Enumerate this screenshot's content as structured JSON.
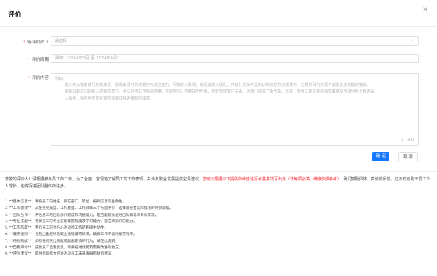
{
  "dialog": {
    "title": "评价"
  },
  "form": {
    "employee": {
      "label": "待评价员工",
      "placeholder": "请选择"
    },
    "period": {
      "label": "评价周期",
      "placeholder": "例如：'2024年1月 至 2024年6月'"
    },
    "content": {
      "label": "评价内容",
      "placeholder": "例如：\n        我三作为销售部门的新成员，展现出极可贵的潜力与适应能力。尽管初入职场，他迅速融入团队，凭借扎实的产品知识和良好的沟通技巧，在短时间内实现了销售业绩的稳定增长。\n        展现出超过同期新人的销售潜力，张三对待工作热情饱满，主动学习，不断提升自我，有效管理客户关系，为部门带来了新气象。未来，望张三能在复杂销售策略及市场分析上有更深\n        入探索，相信他定能在销售领域取得更耀眼的成绩。",
      "count": "0 / 300"
    },
    "confirm_label": "确 定",
    "cancel_label": "取 消"
  },
  "description": {
    "intro": "尊敬的评价人！请根据参与员工的工作，为了全面、客观地了解员工的工作表现，并为其职业发展提供宝贵建议，",
    "warning": "您可以根据以下提供的维度进行考量并填写出点（非每项必填，维度仅供参考）",
    "outro": "，我们鼓励具体、真诚的反馈，这不仅有助于员工个人成长，也将促进团队整体的进步。"
  },
  "criteria": [
    "1. **基本信息**：请按员工的姓名、所在部门、职位、编制信息的准确性。",
    "2. **工作绩效**：从任务完成度、工作质量、工作效率三个方面评价，选择最符合实际情况的评价等级。",
    "3. **团队合作**：评估员工的团队协作态度和沟通能力，是否能有效促进团队和谐与目标实现。",
    "4. **专业技能**：考察员工的专业技能掌握程度及学习能力，适应新知识的能力。",
    "5. **工作态度**：评价员工的责任心及对待工作的积极主动性。",
    "6. **遵守规则**：包括出勤纪律及职业道德遵守情况，确保工作环境的规范有序。",
    "7. **特别贡献**：如有任何突出贡献或超越职责的行为，请在此说明。",
    "8. **自我评价**：鼓励员工自我反思，简要描述优势及需要改进的地方。",
    "9. **评价建议**：提供您的综合评述及对员工未来发展有益的建议。"
  ]
}
